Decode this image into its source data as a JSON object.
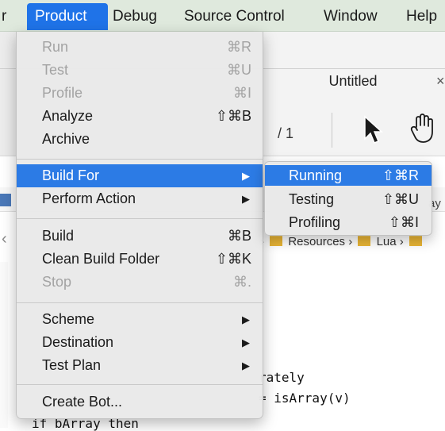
{
  "menubar": {
    "items": [
      {
        "label": "r"
      },
      {
        "label": "Product"
      },
      {
        "label": "Debug"
      },
      {
        "label": "Source Control"
      },
      {
        "label": "Window"
      },
      {
        "label": "Help"
      }
    ]
  },
  "background": {
    "document_title": "Untitled",
    "tab_close": "×",
    "page_count": "/ 1",
    "breadcrumb": {
      "resources": "Resources",
      "lua": "Lua"
    },
    "truncated_label": "ay",
    "code": {
      "line1": "rately",
      "line2": "= isArray(v)",
      "line3": "if bArray then"
    }
  },
  "product_menu": {
    "items": [
      {
        "label": "Run",
        "shortcut": "⌘R"
      },
      {
        "label": "Test",
        "shortcut": "⌘U"
      },
      {
        "label": "Profile",
        "shortcut": "⌘I"
      },
      {
        "label": "Analyze",
        "shortcut": "⇧⌘B"
      },
      {
        "label": "Archive",
        "shortcut": ""
      },
      {
        "label": "Build For",
        "arrow": "▶"
      },
      {
        "label": "Perform Action",
        "arrow": "▶"
      },
      {
        "label": "Build",
        "shortcut": "⌘B"
      },
      {
        "label": "Clean Build Folder",
        "shortcut": "⇧⌘K"
      },
      {
        "label": "Stop",
        "shortcut": "⌘."
      },
      {
        "label": "Scheme",
        "arrow": "▶"
      },
      {
        "label": "Destination",
        "arrow": "▶"
      },
      {
        "label": "Test Plan",
        "arrow": "▶"
      },
      {
        "label": "Create Bot...",
        "shortcut": ""
      }
    ]
  },
  "build_for_submenu": {
    "items": [
      {
        "label": "Running",
        "shortcut": "⇧⌘R"
      },
      {
        "label": "Testing",
        "shortcut": "⇧⌘U"
      },
      {
        "label": "Profiling",
        "shortcut": "⇧⌘I"
      }
    ]
  },
  "colors": {
    "menubar_bg": "#dfe9dd",
    "selection_blue": "#2c7be5",
    "disabled_text": "#a3a3a3"
  }
}
